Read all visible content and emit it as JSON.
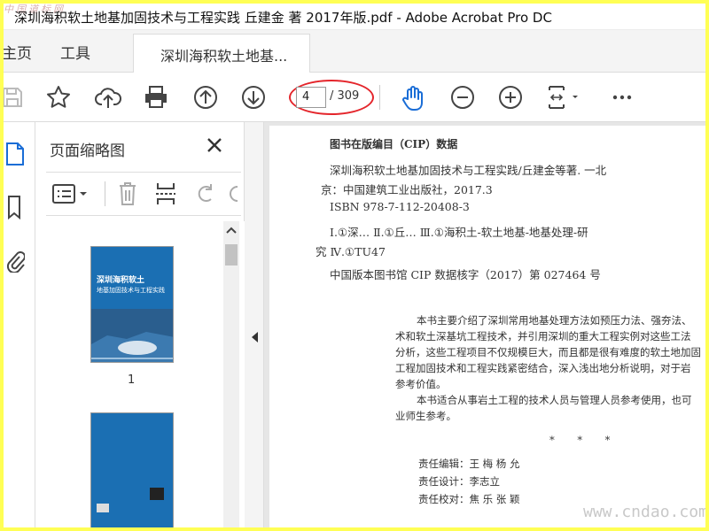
{
  "window": {
    "title": "深圳海积软土地基加固技术与工程实践 丘建金 著 2017年版.pdf - Adobe Acrobat Pro DC",
    "watermark_top": "中国道标网"
  },
  "tabs": {
    "home": "主页",
    "tools": "工具",
    "document": "深圳海积软土地基..."
  },
  "toolbar": {
    "page_current": "4",
    "page_total": "/ 309",
    "icons": [
      "save-icon",
      "star-icon",
      "upload-icon",
      "print-icon",
      "page-up-icon",
      "page-down-icon",
      "hand-icon",
      "zoom-out-icon",
      "zoom-in-icon",
      "fit-page-icon",
      "more-icon"
    ]
  },
  "sidebar": {
    "icons": [
      "page-thumbnails-icon",
      "bookmark-icon",
      "attachment-icon"
    ]
  },
  "pane": {
    "title": "页面缩略图",
    "thumbnails": [
      {
        "label": "1",
        "cover_title": "深圳海积软土",
        "cover_subtitle": "地基加固技术与工程实践"
      },
      {
        "label": "",
        "cover_title": "",
        "cover_subtitle": ""
      }
    ]
  },
  "document": {
    "cip_heading": "图书在版编目（CIP）数据",
    "cip_lines": [
      "深圳海积软土地基加固技术与工程实践/丘建金等著. 一北",
      "京：中国建筑工业出版社，2017.3",
      "ISBN 978-7-112-20408-3",
      "Ⅰ.①深…  Ⅱ.①丘…  Ⅲ.①海积土-软土地基-地基处理-研",
      "究  Ⅳ.①TU47",
      "中国版本图书馆 CIP 数据核字（2017）第 027464 号"
    ],
    "summary_lines": [
      "本书主要介绍了深圳常用地基处理方法如预压力法、强夯法、",
      "术和软土深基坑工程技术，并引用深圳的重大工程实例对这些工法",
      "分析，这些工程项目不仅规模巨大，而且都是很有难度的软土地加固",
      "工程加固技术和工程实践紧密结合，深入浅出地分析说明，对于岩",
      "参考价值。",
      "本书适合从事岩土工程的技术人员与管理人员参考使用，也可",
      "业师生参考。"
    ],
    "asterisks": "*       *       *",
    "credits": [
      "责任编辑：王  梅  杨  允",
      "责任设计：李志立",
      "责任校对：焦  乐  张  颖"
    ]
  },
  "watermark_bottom": "www.cndao.com",
  "colors": {
    "accent_blue": "#1b6fb3",
    "highlight_red": "#e4252b",
    "frame_yellow": "#ffff55"
  }
}
